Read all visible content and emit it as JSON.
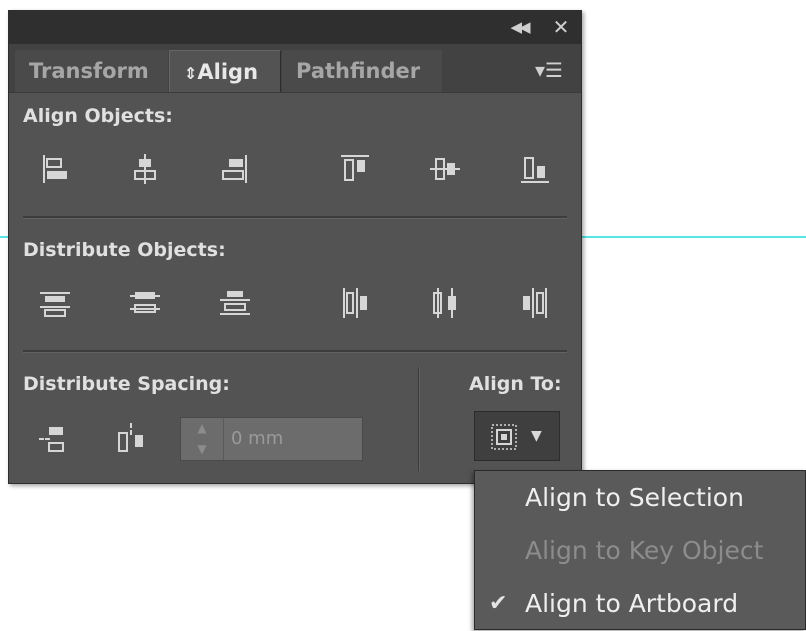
{
  "panel": {
    "titlebar": {
      "collapse_icon": "double-chevron-left",
      "close_icon": "close"
    },
    "tabs": [
      {
        "label": "Transform",
        "active": false
      },
      {
        "label": "Align",
        "active": true,
        "prefix_icon": "up-down-arrows"
      },
      {
        "label": "Pathfinder",
        "active": false
      }
    ],
    "menu_icon": "panel-menu",
    "align_objects": {
      "title": "Align Objects:",
      "buttons": [
        "horizontal-align-left",
        "horizontal-align-center",
        "horizontal-align-right",
        "vertical-align-top",
        "vertical-align-center",
        "vertical-align-bottom"
      ]
    },
    "distribute_objects": {
      "title": "Distribute Objects:",
      "buttons": [
        "vertical-distribute-top",
        "vertical-distribute-center",
        "vertical-distribute-bottom",
        "horizontal-distribute-left",
        "horizontal-distribute-center",
        "horizontal-distribute-right"
      ]
    },
    "distribute_spacing": {
      "title": "Distribute Spacing:",
      "buttons": [
        "vertical-distribute-space",
        "horizontal-distribute-space"
      ],
      "spacing_value": "0 mm"
    },
    "align_to": {
      "title": "Align To:",
      "icon": "align-to-artboard"
    }
  },
  "dropdown": {
    "items": [
      {
        "label": "Align to Selection",
        "enabled": true,
        "checked": false
      },
      {
        "label": "Align to Key Object",
        "enabled": false,
        "checked": false
      },
      {
        "label": "Align to Artboard",
        "enabled": true,
        "checked": true
      }
    ],
    "check_glyph": "✔"
  },
  "colors": {
    "panel_bg": "#535353",
    "titlebar_bg": "#2f2f2f",
    "guide_line": "#57e6e6",
    "menu_bg": "#5a5a5a"
  }
}
